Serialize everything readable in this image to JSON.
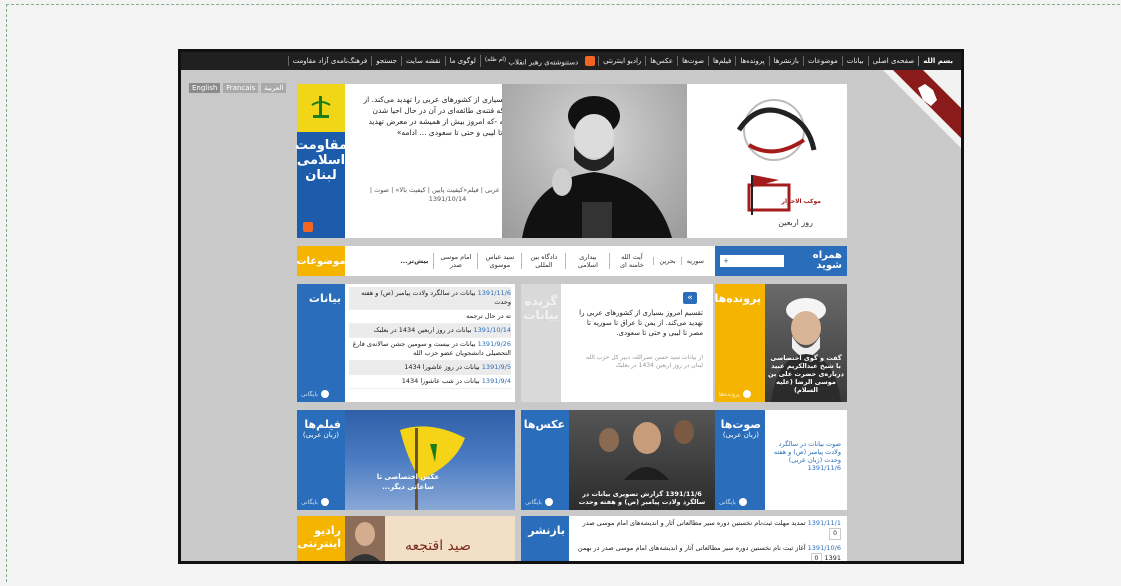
{
  "nav": {
    "items": [
      "بسم الله",
      "صفحه‌ی اصلی",
      "بیانات",
      "موضوعات",
      "بازنشرها",
      "پرونده‌ها",
      "فیلم‌ها",
      "صوت‌ها",
      "عکس‌ها",
      "رادیو اینترنتی",
      "دستنوشته‌ی رهبر انقلاب",
      "لوگوی ما",
      "نقشه سایت",
      "جستجو",
      "فرهنگ‌نامه‌ی آزاد مقاومت"
    ],
    "handwriting_tag": "(ام ظله)"
  },
  "languages": [
    "English",
    "Francais",
    "العربیة"
  ],
  "hero": {
    "text": "تقسیم امروز بسیاری از کشورهای عربی را تهدید می‌کند. از یمن تا عراق -که فتنه‌ی طائفه‌ای در آن در حال احیا شدن است- تا سوریه -که امروز بیش از همیشه در معرض تهدید است- تا مصر تا لیبی و حتی تا سعودی ... ادامه»",
    "links": "فارسی | عربی | فیلم«کیفیت پایین | کیفیت بالا» | صوت | 1391/10/14",
    "arbaeen_caption": "روز اربعین",
    "arbaeen_sub": "موکب الاحرار"
  },
  "resistance": {
    "title": "مقاومت اسلامی لبنان"
  },
  "topics": {
    "label": "موضوعات",
    "items": [
      "سوریه",
      "بحرین",
      "آیت الله خامنه ای",
      "بیداری اسلامی",
      "دادگاه بین المللی",
      "سید عباس موسوی",
      "امام موسی صدر",
      "بیش‌تر..."
    ]
  },
  "join": {
    "label": "همراه شوید",
    "button": "+"
  },
  "statements": {
    "title": "بیانات",
    "more": "بایگانی",
    "rows": [
      {
        "date": "1391/11/6",
        "text": "بیانات در سالگرد ولادت پیامبر (ص) و هفته وحدت"
      },
      {
        "date": "",
        "text": "ته در حال ترجمه"
      },
      {
        "date": "1391/10/14",
        "text": "بیانات در روز اربعین 1434 در بعلبک"
      },
      {
        "date": "1391/9/26",
        "text": "بیانات در بیست و سومین جشن سالانه‌ی فارغ التحصیلی دانشجویان عضو حزب الله"
      },
      {
        "date": "1391/9/5",
        "text": "بیانات در روز عاشورا 1434"
      },
      {
        "date": "1391/9/4",
        "text": "بیانات در شب عاشورا 1434"
      }
    ]
  },
  "quote": {
    "side_label": "گزیده بیانات",
    "icon": "»",
    "text": "تقسیم امروز بسیاری از کشورهای عربی را تهدید می‌کند. از یمن تا عراق تا سوریه تا مصر تا لیبی و حتی تا سعودی.",
    "source": "از بیانات سید حسن نصرالله، دبیر کل حزب الله لبنان در روز اربعین 1434 در بعلبک"
  },
  "files": {
    "title": "پرونده‌ها",
    "caption": "گفت و گوی اختصاصی با شیخ عبدالکریم عبید درباره‌ی حضرت علی بن موسی الرضا (علیه السلام)",
    "more": "پرونده‌ها"
  },
  "films": {
    "title": "فیلم‌ها",
    "sub": "(زبان عربی)",
    "caption": "عکس اختصاصی تا ساعاتی دیگر...",
    "more": "بایگانی"
  },
  "photos": {
    "title": "عکس‌ها",
    "caption": "1391/11/6 گزارش تصویری بیانات در سالگرد ولادت پیامبر (ص) و هفته وحدت",
    "more": "بایگانی"
  },
  "audio": {
    "title": "صوت‌ها",
    "sub": "(زبان عربی)",
    "caption": "صوت بیانات در سالگرد ولادت پیامبر (ص) و هفته وحدت (زبان عربی) 1391/11/6",
    "more": "بایگانی"
  },
  "radio": {
    "title": "رادیو اینترنتی",
    "banner_text": "صید اقتجعه"
  },
  "reposts": {
    "title": "بازنشر",
    "rows": [
      {
        "date": "1391/11/1",
        "text": "تمدید مهلت ثبت‌نام نخستین دوره سیر مطالعاتی آثار و اندیشه‌های امام موسی صدر",
        "count": "0"
      },
      {
        "date": "1391/10/6",
        "text": "آغاز ثبت نام نخستین دوره سیر مطالعاتی آثار و اندیشه‌های امام موسی صدر در بهمن 1391",
        "count": "0"
      }
    ]
  }
}
